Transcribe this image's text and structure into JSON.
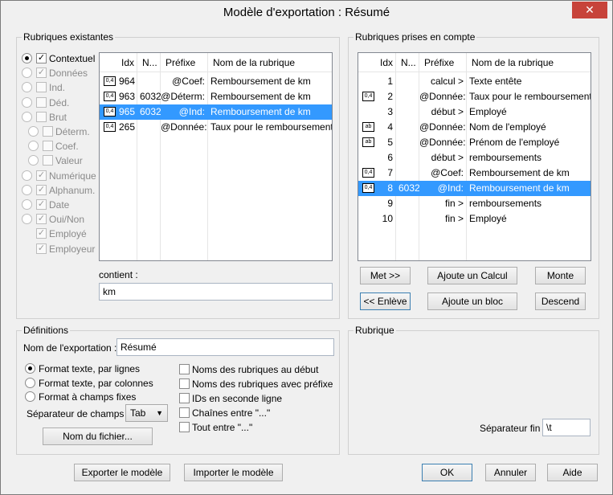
{
  "window": {
    "title": "Modèle d'exportation : Résumé",
    "close_glyph": "✕"
  },
  "left_group": {
    "title": "Rubriques existantes",
    "filters": [
      {
        "label": "Contextuel",
        "radio": true,
        "radio_on": true,
        "check": true,
        "checked": true,
        "enabled": true
      },
      {
        "label": "Données",
        "radio": true,
        "radio_on": false,
        "check": true,
        "checked": true,
        "enabled": false
      },
      {
        "label": "Ind.",
        "radio": true,
        "radio_on": false,
        "check": true,
        "checked": false,
        "enabled": false
      },
      {
        "label": "Déd.",
        "radio": true,
        "radio_on": false,
        "check": true,
        "checked": false,
        "enabled": false
      },
      {
        "label": "Brut",
        "radio": true,
        "radio_on": false,
        "check": true,
        "checked": false,
        "enabled": false
      },
      {
        "label": "Déterm.",
        "radio": true,
        "radio_on": false,
        "check": true,
        "checked": false,
        "enabled": false
      },
      {
        "label": "Coef.",
        "radio": true,
        "radio_on": false,
        "check": true,
        "checked": false,
        "enabled": false
      },
      {
        "label": "Valeur",
        "radio": true,
        "radio_on": false,
        "check": true,
        "checked": false,
        "enabled": false
      },
      {
        "label": "Numérique",
        "radio": true,
        "radio_on": false,
        "check": true,
        "checked": true,
        "enabled": false
      },
      {
        "label": "Alphanum.",
        "radio": true,
        "radio_on": false,
        "check": true,
        "checked": true,
        "enabled": false
      },
      {
        "label": "Date",
        "radio": true,
        "radio_on": false,
        "check": true,
        "checked": true,
        "enabled": false
      },
      {
        "label": "Oui/Non",
        "radio": true,
        "radio_on": false,
        "check": true,
        "checked": true,
        "enabled": false
      },
      {
        "label": "Employé",
        "radio": false,
        "radio_on": false,
        "check": true,
        "checked": true,
        "enabled": false
      },
      {
        "label": "Employeur",
        "radio": false,
        "radio_on": false,
        "check": true,
        "checked": true,
        "enabled": false
      }
    ],
    "columns": [
      "Idx",
      "N...",
      "Préfixe",
      "Nom de la rubrique"
    ],
    "rows": [
      {
        "badge": "0,4",
        "idx": "964",
        "n": "",
        "prefix": "@Coef:",
        "name": "Remboursement de km",
        "selected": false
      },
      {
        "badge": "0,4",
        "idx": "963",
        "n": "6032.",
        "prefix": "@Déterm:",
        "name": "Remboursement de km",
        "selected": false
      },
      {
        "badge": "0,4",
        "idx": "965",
        "n": "6032.",
        "prefix": "@Ind:",
        "name": "Remboursement de km",
        "selected": true
      },
      {
        "badge": "0,4",
        "idx": "265",
        "n": "",
        "prefix": "@Donnée:",
        "name": "Taux pour le remboursement de",
        "selected": false
      }
    ],
    "contains_label": "contient :",
    "contains_value": "km"
  },
  "right_group": {
    "title": "Rubriques prises en compte",
    "columns": [
      "Idx",
      "N...",
      "Préfixe",
      "Nom de la rubrique"
    ],
    "rows": [
      {
        "badge": "",
        "idx": "1",
        "n": "",
        "prefix": "calcul >",
        "name": "Texte entête",
        "selected": false
      },
      {
        "badge": "0,4",
        "idx": "2",
        "n": "",
        "prefix": "@Donnée:",
        "name": "Taux pour le remboursement de",
        "selected": false
      },
      {
        "badge": "",
        "idx": "3",
        "n": "",
        "prefix": "début >",
        "name": "Employé",
        "selected": false
      },
      {
        "badge": "ab",
        "idx": "4",
        "n": "",
        "prefix": "@Donnée:",
        "name": "Nom de l'employé",
        "selected": false
      },
      {
        "badge": "ab",
        "idx": "5",
        "n": "",
        "prefix": "@Donnée:",
        "name": "Prénom de l'employé",
        "selected": false
      },
      {
        "badge": "",
        "idx": "6",
        "n": "",
        "prefix": "début >",
        "name": "remboursements",
        "selected": false
      },
      {
        "badge": "0,4",
        "idx": "7",
        "n": "",
        "prefix": "@Coef:",
        "name": "Remboursement de km",
        "selected": false
      },
      {
        "badge": "0,4",
        "idx": "8",
        "n": "6032.",
        "prefix": "@Ind:",
        "name": "Remboursement de km",
        "selected": true
      },
      {
        "badge": "",
        "idx": "9",
        "n": "",
        "prefix": "fin >",
        "name": "remboursements",
        "selected": false
      },
      {
        "badge": "",
        "idx": "10",
        "n": "",
        "prefix": "fin >",
        "name": "Employé",
        "selected": false
      }
    ],
    "buttons": {
      "put": "Met >>",
      "add_calc": "Ajoute un Calcul",
      "up": "Monte",
      "remove": "<< Enlève",
      "add_block": "Ajoute un bloc",
      "down": "Descend"
    }
  },
  "definitions": {
    "title": "Définitions",
    "name_label": "Nom de l'exportation :",
    "name_value": "Résumé",
    "formats": [
      {
        "label": "Format texte, par lignes",
        "selected": true
      },
      {
        "label": "Format texte, par colonnes",
        "selected": false
      },
      {
        "label": "Format à champs fixes",
        "selected": false
      }
    ],
    "options": [
      {
        "label": "Noms des rubriques au début",
        "checked": false
      },
      {
        "label": "Noms des rubriques avec préfixe",
        "checked": false
      },
      {
        "label": "IDs en seconde ligne",
        "checked": false
      },
      {
        "label": "Chaînes entre \"...\"",
        "checked": false
      },
      {
        "label": "Tout entre \"...\"",
        "checked": false
      }
    ],
    "separator_label": "Séparateur de champs :",
    "separator_value": "Tab",
    "filename_button": "Nom du fichier..."
  },
  "rubrique": {
    "title": "Rubrique",
    "end_sep_label": "Séparateur fin :",
    "end_sep_value": "\\t"
  },
  "footer": {
    "export_model": "Exporter le modèle",
    "import_model": "Importer le modèle",
    "ok": "OK",
    "cancel": "Annuler",
    "help": "Aide"
  }
}
